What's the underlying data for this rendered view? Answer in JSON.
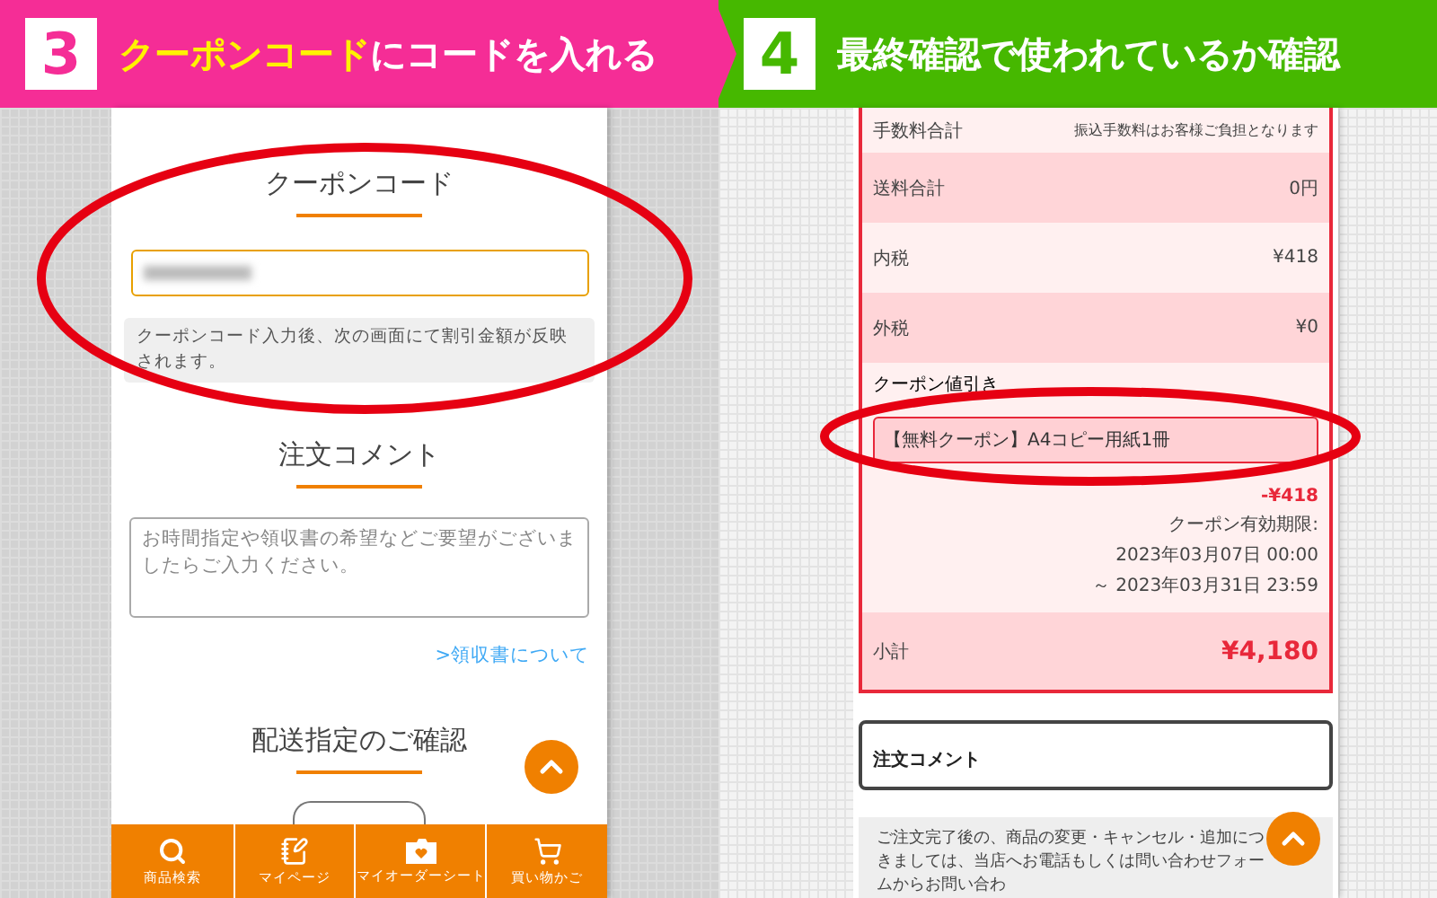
{
  "steps": [
    {
      "number": "3",
      "color": "#f52d96",
      "title_parts": [
        {
          "text": "クーポンコード",
          "highlight": true
        },
        {
          "text": "にコードを入れる",
          "highlight": false
        }
      ]
    },
    {
      "number": "4",
      "color": "#46b800",
      "title_parts": [
        {
          "text": "最終確認で使われているか確認",
          "highlight": false
        }
      ]
    }
  ],
  "left_screen": {
    "coupon_section": {
      "title": "クーポンコード"
    },
    "coupon_notice": "クーポンコード入力後、次の画面にて割引金額が反映されます。",
    "comment_section": {
      "title": "注文コメント",
      "placeholder": "お時間指定や領収書の希望などご要望がございましたらご入力ください。"
    },
    "receipt_link": ">領収書について",
    "delivery_section": {
      "title": "配送指定のご確認"
    },
    "bottom_nav": [
      {
        "kind": "search",
        "label": "商品検索"
      },
      {
        "kind": "mypage",
        "label": "マイページ"
      },
      {
        "kind": "ordersheet",
        "label": "マイオーダーシート"
      },
      {
        "kind": "cart",
        "label": "買い物かご"
      }
    ]
  },
  "right_screen": {
    "summary_rows": [
      {
        "label": "手数料合計",
        "value": "振込手数料はお客様ご負担となります"
      },
      {
        "label": "送料合計",
        "value": "0円"
      },
      {
        "label": "内税",
        "value": "¥418"
      },
      {
        "label": "外税",
        "value": "¥0"
      }
    ],
    "coupon": {
      "label": "クーポン値引き",
      "name": "【無料クーポン】A4コピー用紙1冊",
      "discount": "-¥418",
      "validity_label": "クーポン有効期限:",
      "validity_from": "2023年03月07日 00:00",
      "validity_to": "～ 2023年03月31日 23:59"
    },
    "subtotal": {
      "label": "小計",
      "value": "¥4,180"
    },
    "comment_box": {
      "title": "注文コメント"
    },
    "notice": "ご注文完了後の、商品の変更・キャンセル・追加につきましては、当店へお電話もしくは問い合わせフォームからお問い合わ"
  }
}
